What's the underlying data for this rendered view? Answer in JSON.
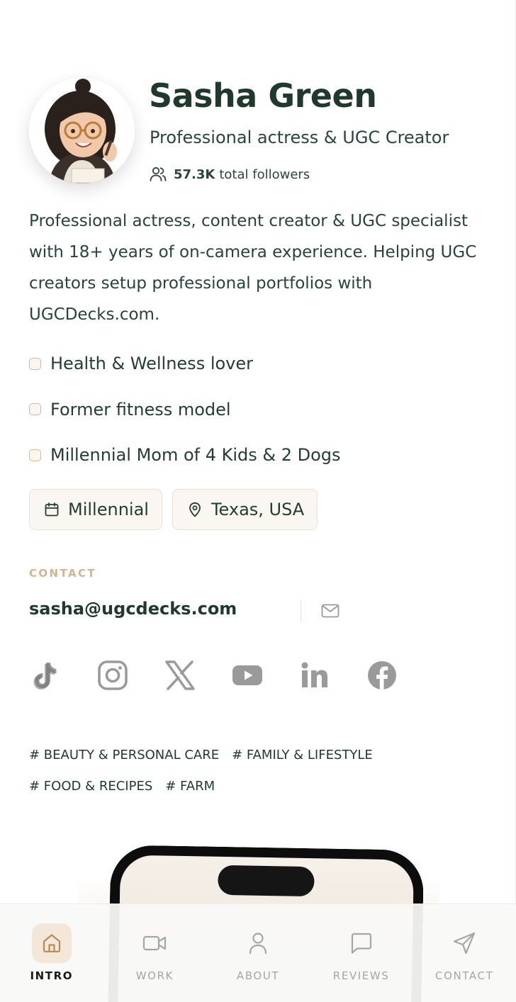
{
  "profile": {
    "name": "Sasha Green",
    "tagline": "Professional actress & UGC Creator",
    "followers_count": "57.3K",
    "followers_label": "total followers",
    "avatar_alt": "Sasha Green avatar"
  },
  "bio": "Professional actress, content creator & UGC specialist with 18+ years of on-camera experience. Helping UGC creators setup professional portfolios with UGCDecks.com.",
  "traits": [
    "Health & Wellness lover",
    "Former fitness model",
    "Millennial Mom of 4 Kids & 2 Dogs"
  ],
  "chips": {
    "generation": "Millennial",
    "location": "Texas, USA"
  },
  "contact": {
    "label": "CONTACT",
    "email": "sasha@ugcdecks.com"
  },
  "socials": [
    "tiktok-icon",
    "instagram-icon",
    "x-icon",
    "youtube-icon",
    "linkedin-icon",
    "facebook-icon"
  ],
  "tags": [
    [
      "# BEAUTY & PERSONAL CARE",
      "# FAMILY & LIFESTYLE"
    ],
    [
      "# FOOD & RECIPES",
      "# FARM"
    ]
  ],
  "nav": {
    "items": [
      {
        "label": "INTRO",
        "icon": "home-icon",
        "active": true
      },
      {
        "label": "WORK",
        "icon": "video-icon",
        "active": false
      },
      {
        "label": "ABOUT",
        "icon": "user-icon",
        "active": false
      },
      {
        "label": "REVIEWS",
        "icon": "chat-icon",
        "active": false
      },
      {
        "label": "CONTACT",
        "icon": "send-icon",
        "active": false
      }
    ]
  },
  "colors": {
    "text_dark": "#1f3a2d",
    "accent_beige": "#d4b48e",
    "chip_bg": "#faf7f2",
    "nav_active_bg": "#f3e7d9",
    "icon_gray": "#9a9a9a"
  }
}
